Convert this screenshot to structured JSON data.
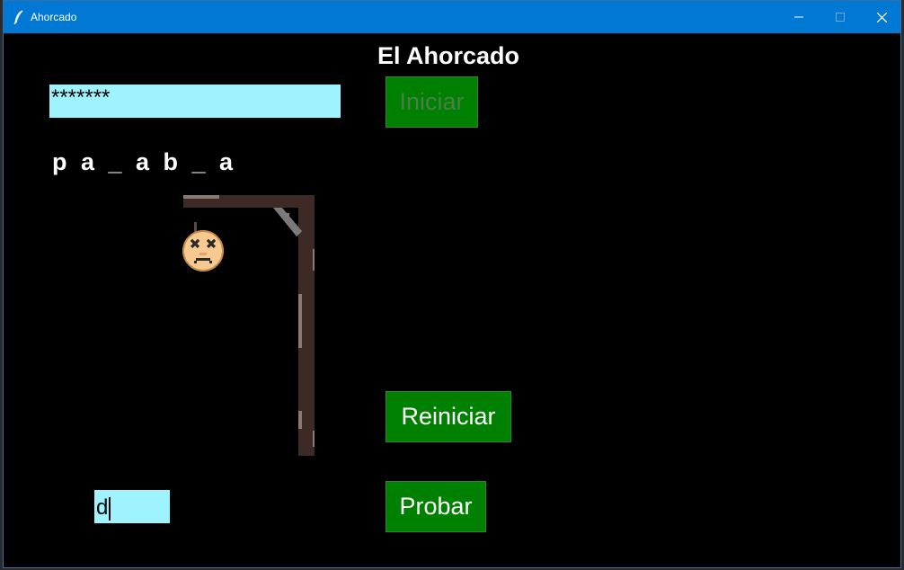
{
  "window": {
    "title": "Ahorcado"
  },
  "app": {
    "title": "El Ahorcado",
    "secret_value": "*******",
    "start_label": "Iniciar",
    "word_display": "p a _ a b _ a",
    "reset_label": "Reiniciar",
    "try_label": "Probar",
    "letter_value": "d"
  },
  "icons": {
    "app_icon": "feather-icon",
    "minimize": "minimize-icon",
    "maximize": "maximize-icon",
    "close": "close-icon"
  },
  "colors": {
    "titlebar": "#0078d4",
    "background": "#000000",
    "entry": "#9ff3ff",
    "button": "#008000"
  }
}
